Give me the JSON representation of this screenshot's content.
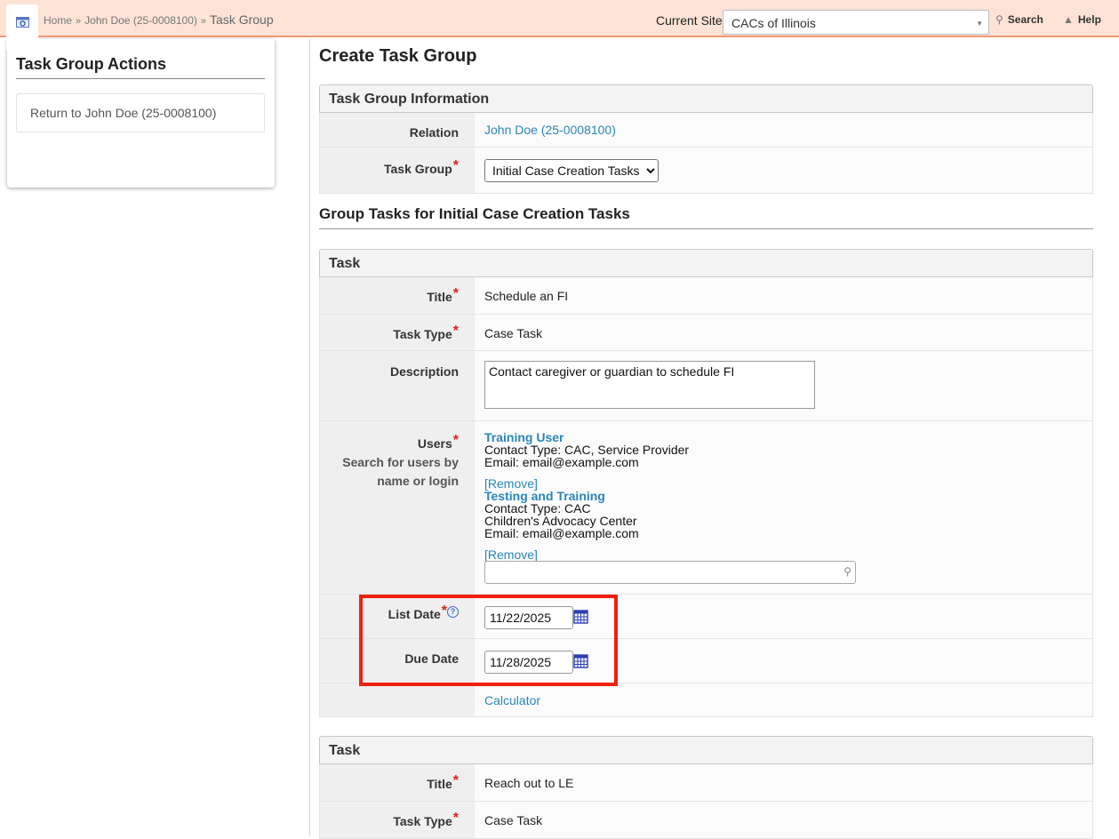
{
  "breadcrumb": {
    "home": "Home",
    "sep": "»",
    "person": "John Doe (25-0008100)",
    "current": "Task Group"
  },
  "topbar": {
    "site_label": "Current Site",
    "site_value": "CACs of Illinois",
    "search_label": "Search",
    "help_label": "Help"
  },
  "sidebar": {
    "title": "Task Group Actions",
    "action": "Return to John Doe (25-0008100)"
  },
  "page": {
    "title": "Create Task Group"
  },
  "info": {
    "header": "Task Group Information",
    "relation_label": "Relation",
    "relation_value": "John Doe (25-0008100)",
    "group_label": "Task Group",
    "group_value": "Initial Case Creation Tasks"
  },
  "group_tasks_title": "Group Tasks for Initial Case Creation Tasks",
  "task1": {
    "header": "Task",
    "title_label": "Title",
    "title_value": "Schedule an FI",
    "type_label": "Task Type",
    "type_value": "Case Task",
    "desc_label": "Description",
    "desc_value": "Contact caregiver or guardian to schedule FI",
    "users_label": "Users",
    "users_hint": "Search for users by name or login",
    "users": [
      {
        "name": "Training User",
        "line1": "Contact Type: CAC, Service Provider",
        "line2": "Email: email@example.com",
        "remove": "[Remove]"
      },
      {
        "name": "Testing and Training",
        "line1": "Contact Type: CAC",
        "line2": "Children's Advocacy Center",
        "line3": "Email: email@example.com",
        "remove": "[Remove]"
      }
    ],
    "list_date_label": "List Date",
    "list_date": "11/22/2025",
    "due_date_label": "Due Date",
    "due_date": "11/28/2025",
    "calculator": "Calculator"
  },
  "task2": {
    "header": "Task",
    "title_label": "Title",
    "title_value": "Reach out to LE",
    "type_label": "Task Type",
    "type_value": "Case Task"
  },
  "colors": {
    "topbar_bg": "#fde3d6",
    "accent": "#f29a72",
    "link": "#2a86b8",
    "required": "#e02020",
    "highlight": "#f0200f"
  },
  "icons": [
    "home-icon",
    "search-icon",
    "help-icon",
    "calendar-icon",
    "info-icon",
    "magnifier-icon"
  ]
}
